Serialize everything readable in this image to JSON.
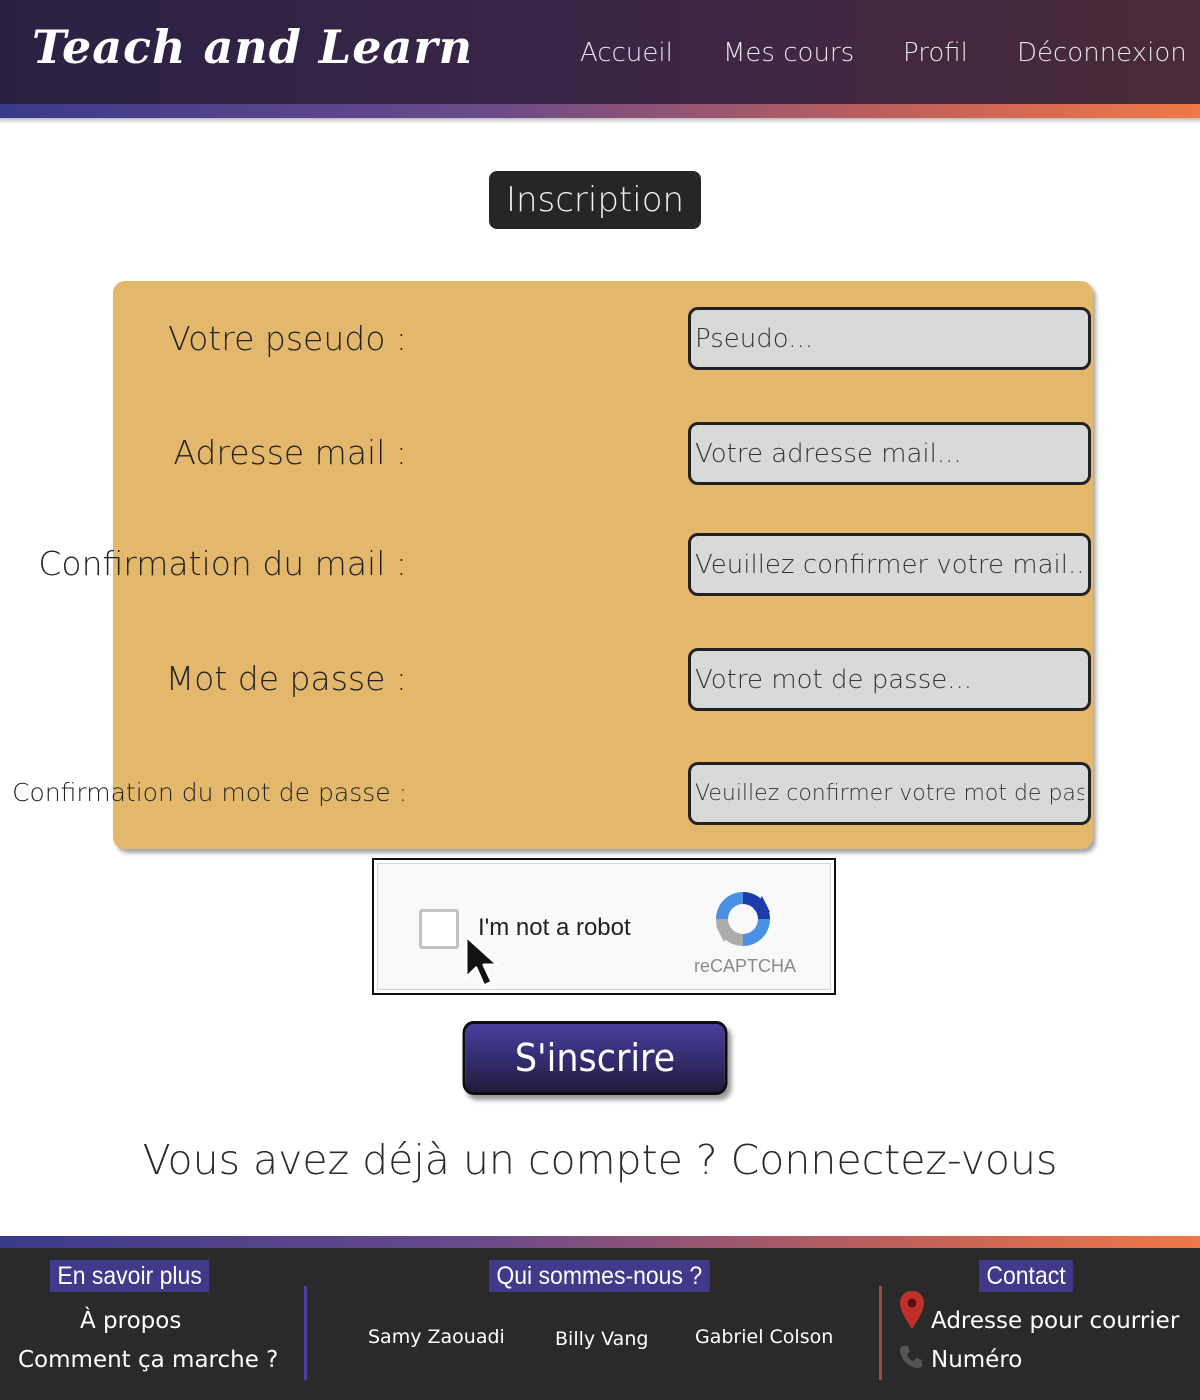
{
  "header": {
    "logo": "Teach  and Learn",
    "nav": [
      "Accueil",
      "Mes cours",
      "Profil",
      "Déconnexion"
    ]
  },
  "page_title": "Inscription",
  "form": {
    "fields": [
      {
        "label": "Votre pseudo :",
        "placeholder": "Pseudo..."
      },
      {
        "label": "Adresse mail :",
        "placeholder": "Votre adresse mail..."
      },
      {
        "label": "Confirmation du mail :",
        "placeholder": "Veuillez confirmer votre mail..."
      },
      {
        "label": "Mot de passe :",
        "placeholder": "Votre mot de passe..."
      },
      {
        "label": "Confirmation du mot de passe :",
        "placeholder": "Veuillez confirmer votre mot de passe"
      }
    ]
  },
  "captcha": {
    "text": "I'm not a robot",
    "brand": "reCAPTCHA"
  },
  "submit_label": "S'inscrire",
  "login_prompt": "Vous avez déjà un compte ? Connectez-vous",
  "footer": {
    "col1": {
      "heading": "En savoir plus",
      "links": [
        "À propos",
        "Comment ça marche ?"
      ]
    },
    "col2": {
      "heading": "Qui sommes-nous ?",
      "names": [
        "Samy Zaouadi",
        "Billy Vang",
        "Gabriel Colson"
      ]
    },
    "col3": {
      "heading": "Contact",
      "items": [
        "Adresse pour courrier",
        "Numéro"
      ]
    }
  },
  "colors": {
    "header_bg": "#2a2142",
    "form_bg": "#e4b86c",
    "button": "#352d72",
    "footer_bg": "#2a2a2a",
    "footer_heading_bg": "#413a8a"
  },
  "icons": [
    "cursor-icon",
    "recaptcha-icon",
    "map-pin-icon",
    "phone-icon"
  ]
}
